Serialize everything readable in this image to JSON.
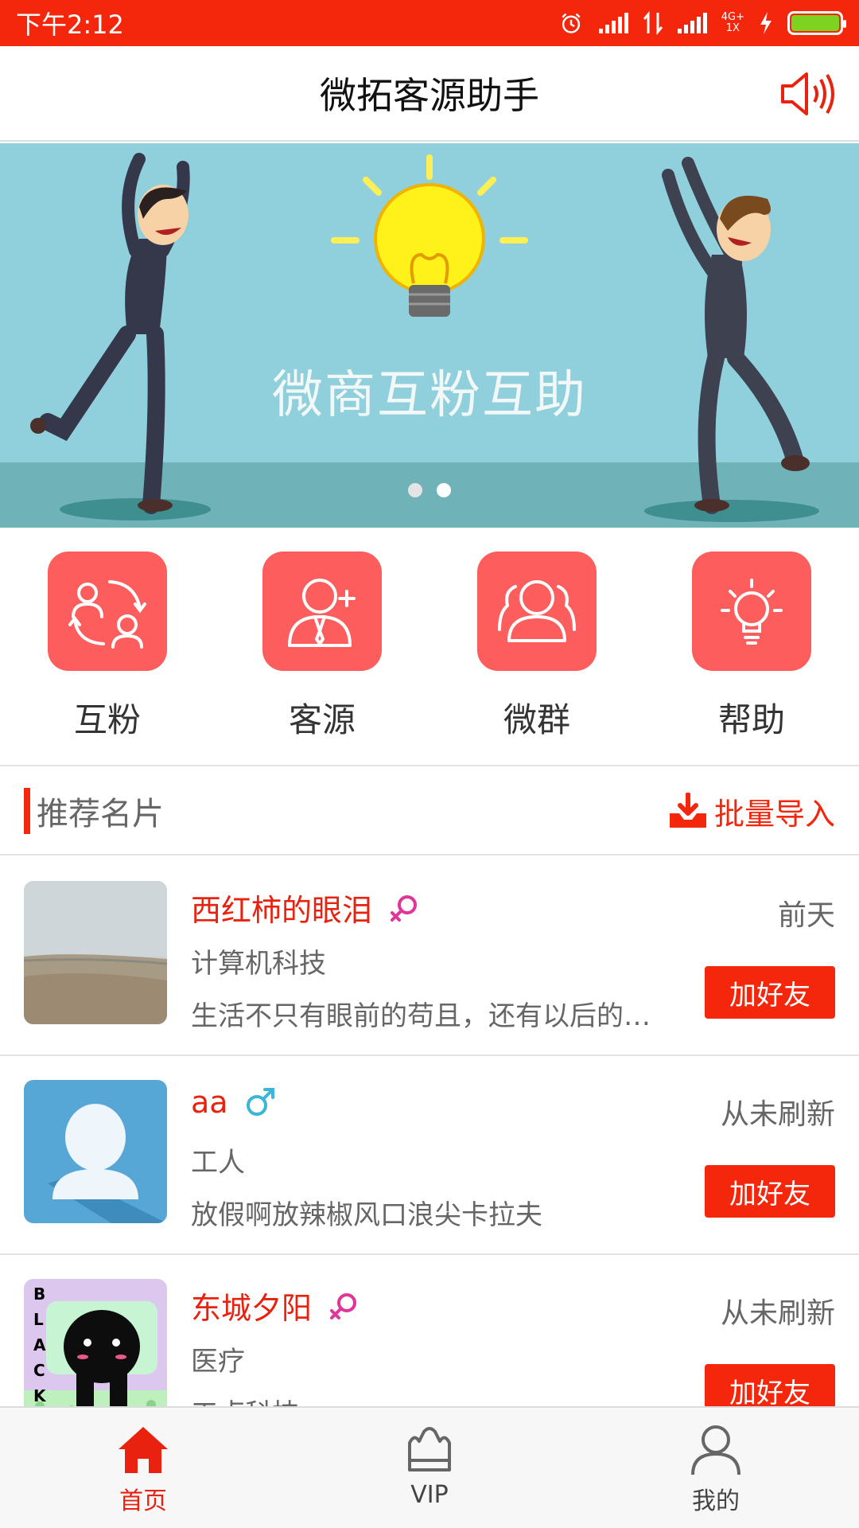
{
  "status_bar": {
    "time": "下午2:12",
    "network_label_top": "4G+",
    "network_label_bottom": "1X"
  },
  "header": {
    "title": "微拓客源助手",
    "speaker_icon": "speaker-icon"
  },
  "banner": {
    "slogan": "微商互粉互助",
    "slides": 2,
    "active_slide": 2
  },
  "quick_actions": [
    {
      "label": "互粉",
      "icon": "mutual-follow-icon"
    },
    {
      "label": "客源",
      "icon": "add-customer-icon"
    },
    {
      "label": "微群",
      "icon": "group-icon"
    },
    {
      "label": "帮助",
      "icon": "lightbulb-icon"
    }
  ],
  "section": {
    "title": "推荐名片",
    "import_label": "批量导入"
  },
  "cards": [
    {
      "name": "西红柿的眼泪",
      "gender": "female",
      "job": "计算机科技",
      "desc": "生活不只有眼前的苟且，还有以后的…",
      "time": "前天",
      "button": "加好友"
    },
    {
      "name": "aa",
      "gender": "male",
      "job": "工人",
      "desc": "放假啊放辣椒风口浪尖卡拉夫",
      "time": "从未刷新",
      "button": "加好友"
    },
    {
      "name": "东城夕阳",
      "gender": "female",
      "job": "医疗",
      "desc": "工卢科技",
      "time": "从未刷新",
      "button": "加好友"
    }
  ],
  "tabs": [
    {
      "label": "首页",
      "icon": "home-icon",
      "active": true
    },
    {
      "label": "VIP",
      "icon": "crown-icon",
      "active": false
    },
    {
      "label": "我的",
      "icon": "profile-icon",
      "active": false
    }
  ],
  "colors": {
    "primary": "#f4260c",
    "accent_tile": "#fd5d5d",
    "female": "#e0359a",
    "male": "#3ab7d8",
    "banner_sky": "#8fd0dc"
  }
}
